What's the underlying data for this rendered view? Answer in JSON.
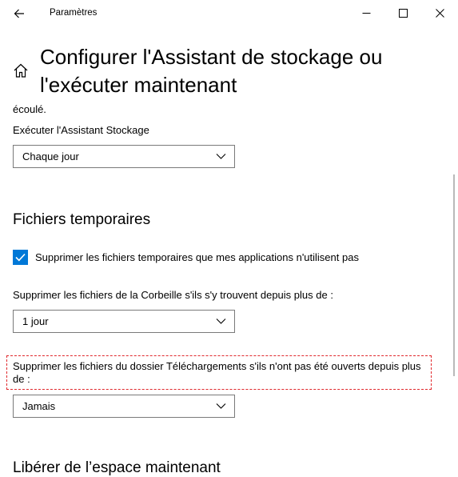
{
  "window": {
    "title": "Paramètres"
  },
  "page": {
    "title": "Configurer l'Assistant de stockage ou l'exécuter maintenant",
    "fragment": "écoulé."
  },
  "run_section": {
    "label": "Exécuter l'Assistant Stockage",
    "dropdown_value": "Chaque jour"
  },
  "temp_section": {
    "heading": "Fichiers temporaires",
    "checkbox_label": "Supprimer les fichiers temporaires que mes applications n'utilisent pas",
    "checkbox_checked": true,
    "recycle_label": "Supprimer les fichiers de la Corbeille s'ils s'y trouvent depuis plus de :",
    "recycle_value": "1 jour",
    "downloads_label": "Supprimer les fichiers du dossier Téléchargements s'ils n'ont pas été ouverts depuis plus de :",
    "downloads_value": "Jamais"
  },
  "free_section": {
    "heading": "Libérer de l’espace maintenant"
  },
  "icons": {
    "back": "back-arrow-icon",
    "home": "home-icon",
    "minimize": "minimize-icon",
    "maximize": "maximize-icon",
    "close": "close-icon",
    "chevron": "chevron-down-icon",
    "check": "checkmark-icon"
  },
  "colors": {
    "accent": "#0078d7",
    "highlight_border": "#e0282c"
  }
}
